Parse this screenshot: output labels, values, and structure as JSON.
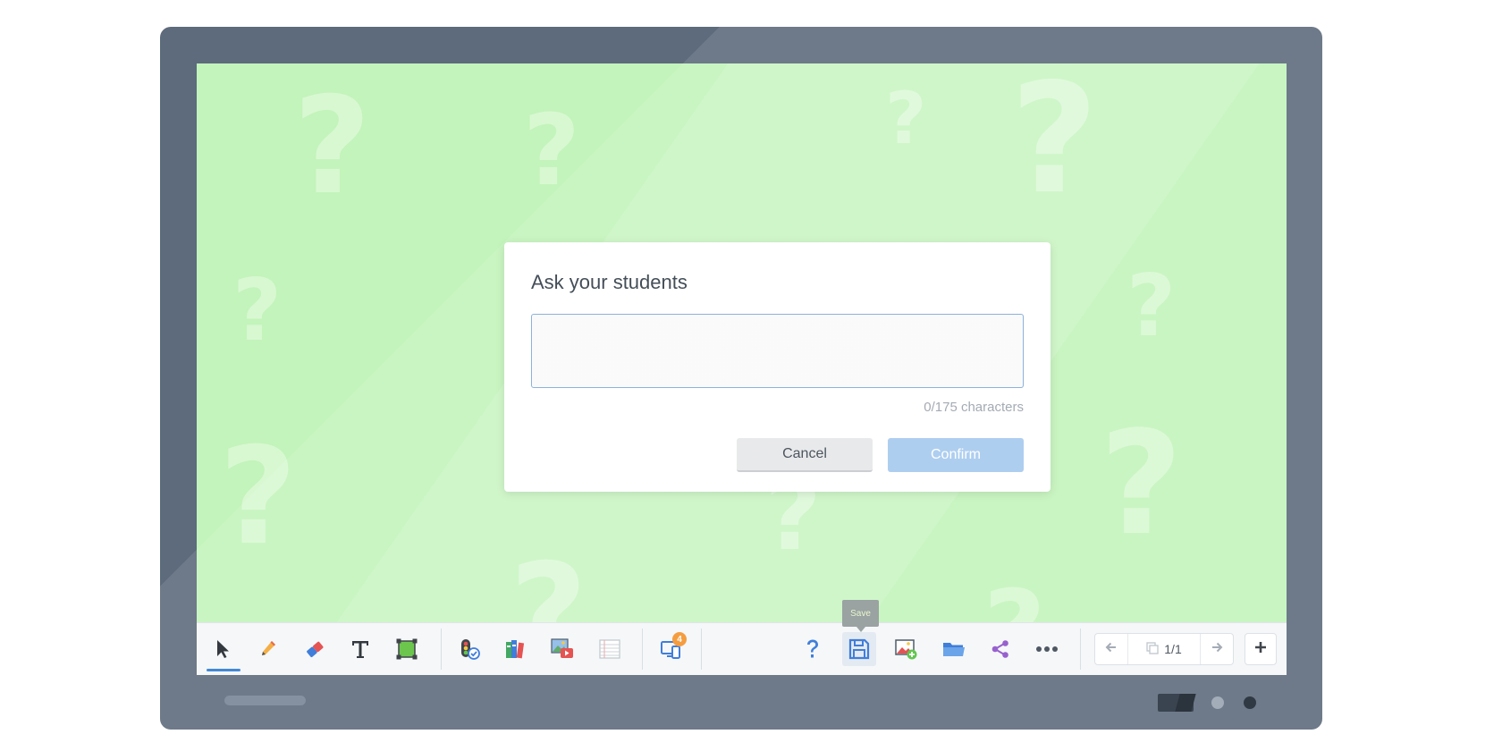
{
  "dialog": {
    "title": "Ask your students",
    "input_value": "",
    "input_placeholder": "",
    "char_count": "0/175 characters",
    "cancel_label": "Cancel",
    "confirm_label": "Confirm"
  },
  "toolbar": {
    "tools": [
      {
        "name": "select",
        "icon": "cursor-arrow-icon",
        "active": true
      },
      {
        "name": "pen",
        "icon": "pencil-icon"
      },
      {
        "name": "eraser",
        "icon": "eraser-icon"
      },
      {
        "name": "text",
        "icon": "text-T-icon"
      },
      {
        "name": "shape",
        "icon": "shape-square-icon"
      },
      {
        "name": "quiz",
        "icon": "traffic-light-check-icon"
      },
      {
        "name": "library",
        "icon": "books-icon"
      },
      {
        "name": "media",
        "icon": "image-video-icon"
      },
      {
        "name": "lines",
        "icon": "lined-paper-icon"
      },
      {
        "name": "devices",
        "icon": "devices-icon"
      },
      {
        "name": "question",
        "icon": "question-mark-icon"
      },
      {
        "name": "save",
        "icon": "save-icon"
      },
      {
        "name": "add-image",
        "icon": "image-add-icon"
      },
      {
        "name": "open",
        "icon": "folder-icon"
      },
      {
        "name": "share",
        "icon": "share-icon"
      },
      {
        "name": "more",
        "icon": "more-dots-icon"
      }
    ],
    "devices_badge": "4",
    "tooltip": "Save",
    "page_indicator": "1/1"
  },
  "colors": {
    "background_green": "#c3f4bb",
    "bezel": "#5d6b7c",
    "confirm_button": "#a5c9ee",
    "accent_blue": "#2c7bd0",
    "badge_orange": "#f3922a"
  }
}
